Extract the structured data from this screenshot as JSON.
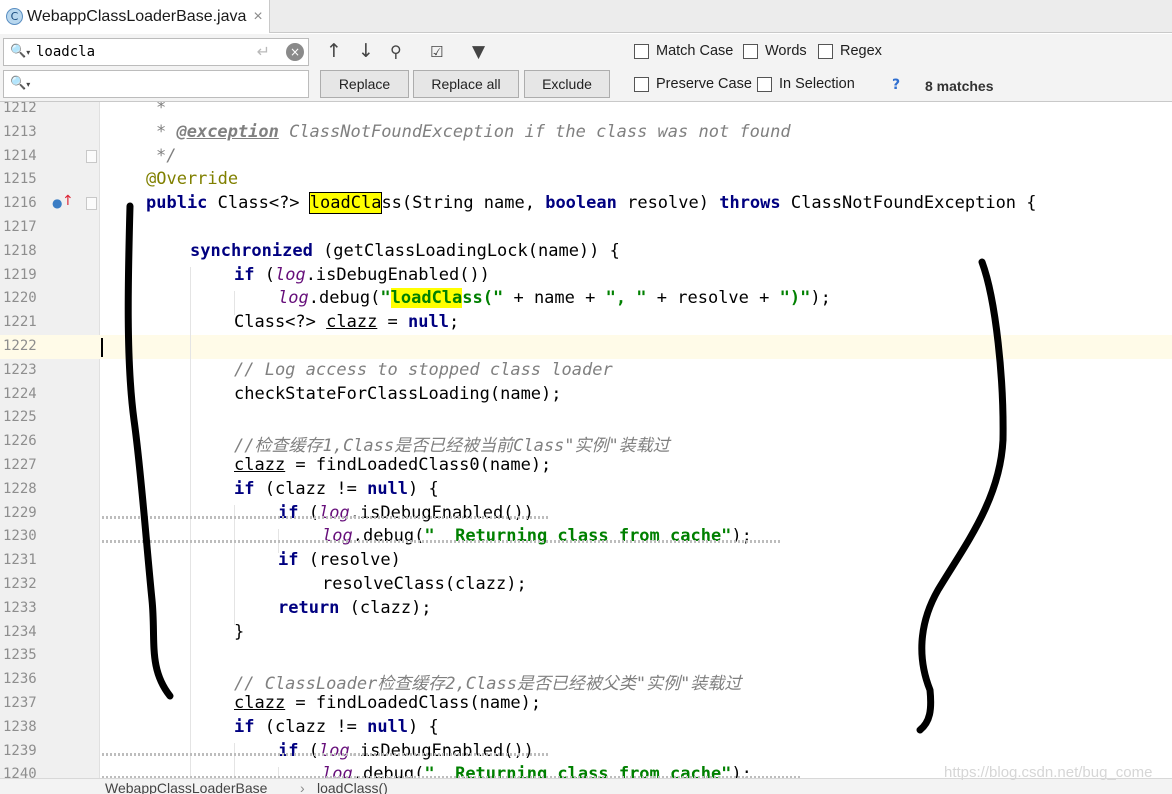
{
  "tab": {
    "icon": "C",
    "title": "WebappClassLoaderBase.java",
    "close": "×"
  },
  "search": {
    "query": "loadcla",
    "replace_value": "",
    "buttons": {
      "replace": "Replace",
      "replace_all": "Replace all",
      "exclude": "Exclude"
    },
    "options": {
      "match_case": "Match Case",
      "words": "Words",
      "regex": "Regex",
      "help": "?",
      "preserve_case": "Preserve Case",
      "in_selection": "In Selection"
    },
    "matches": "8 matches"
  },
  "editor": {
    "lines": [
      {
        "n": "1212",
        "t": [
          [
            "jdoc",
            "*"
          ]
        ]
      },
      {
        "n": "1213",
        "t": [
          [
            "jdoc",
            "* "
          ],
          [
            "jtag",
            "@exception"
          ],
          [
            "jdoc",
            " ClassNotFoundException if the class was not found"
          ]
        ]
      },
      {
        "n": "1214",
        "t": [
          [
            "jdoc",
            "*/"
          ]
        ]
      },
      {
        "n": "1215",
        "t": [
          [
            "ann",
            "@Override"
          ]
        ]
      },
      {
        "n": "1216",
        "t": [
          [
            "kw",
            "public"
          ],
          [
            "",
            " Class<?> "
          ],
          [
            "hlbox",
            "loadCla"
          ],
          [
            "",
            "ss(String name, "
          ],
          [
            "kw",
            "boolean"
          ],
          [
            "",
            " resolve) "
          ],
          [
            "kw",
            "throws"
          ],
          [
            "",
            " ClassNotFoundException {"
          ]
        ]
      },
      {
        "n": "1217",
        "t": []
      },
      {
        "n": "1218",
        "t": [
          [
            "kw",
            "synchronized"
          ],
          [
            "",
            " (getClassLoadingLock(name)) {"
          ]
        ]
      },
      {
        "n": "1219",
        "t": [
          [
            "kw",
            "if"
          ],
          [
            "",
            " ("
          ],
          [
            "fld",
            "log"
          ],
          [
            "",
            ".isDebugEnabled())"
          ]
        ]
      },
      {
        "n": "1220",
        "t": [
          [
            "fld",
            "log"
          ],
          [
            "",
            ".debug("
          ],
          [
            "str",
            "\""
          ],
          [
            "strhl",
            "loadCla"
          ],
          [
            "str",
            "ss(\""
          ],
          [
            "",
            " + name + "
          ],
          [
            "str",
            "\", \""
          ],
          [
            "",
            " + resolve + "
          ],
          [
            "str",
            "\")\""
          ],
          [
            "",
            ");"
          ]
        ]
      },
      {
        "n": "1221",
        "t": [
          [
            "",
            "Class<?> "
          ],
          [
            "und",
            "clazz"
          ],
          [
            "",
            " = "
          ],
          [
            "kwnull",
            "null"
          ],
          [
            "",
            ";"
          ]
        ]
      },
      {
        "n": "1222",
        "t": []
      },
      {
        "n": "1223",
        "t": [
          [
            "cmt",
            "// Log access to stopped class loader"
          ]
        ]
      },
      {
        "n": "1224",
        "t": [
          [
            "",
            "checkStateForClassLoading(name);"
          ]
        ]
      },
      {
        "n": "1225",
        "t": []
      },
      {
        "n": "1226",
        "t": [
          [
            "cmt",
            "//检查缓存1,Class是否已经被当前Class\"实例\"装载过"
          ]
        ]
      },
      {
        "n": "1227",
        "t": [
          [
            "und",
            "clazz"
          ],
          [
            "",
            " = findLoadedClass0(name);"
          ]
        ]
      },
      {
        "n": "1228",
        "t": [
          [
            "kw",
            "if"
          ],
          [
            "",
            " (clazz != "
          ],
          [
            "kwnull",
            "null"
          ],
          [
            "",
            ") {"
          ]
        ]
      },
      {
        "n": "1229",
        "t": [
          [
            "kw",
            "if"
          ],
          [
            "",
            " ("
          ],
          [
            "fld",
            "log"
          ],
          [
            "",
            ".isDebugEnabled())"
          ]
        ]
      },
      {
        "n": "1230",
        "t": [
          [
            "fld",
            "log"
          ],
          [
            "",
            ".debug("
          ],
          [
            "str",
            "\"  Returning class from cache\""
          ],
          [
            "",
            ");"
          ]
        ]
      },
      {
        "n": "1231",
        "t": [
          [
            "kw",
            "if"
          ],
          [
            "",
            " (resolve)"
          ]
        ]
      },
      {
        "n": "1232",
        "t": [
          [
            "",
            "resolveClass(clazz);"
          ]
        ]
      },
      {
        "n": "1233",
        "t": [
          [
            "kw",
            "return"
          ],
          [
            "",
            " (clazz);"
          ]
        ]
      },
      {
        "n": "1234",
        "t": [
          [
            "",
            "}"
          ]
        ]
      },
      {
        "n": "1235",
        "t": []
      },
      {
        "n": "1236",
        "t": [
          [
            "cmt",
            "// ClassLoader检查缓存2,Class是否已经被父类\"实例\"装载过"
          ]
        ]
      },
      {
        "n": "1237",
        "t": [
          [
            "und",
            "clazz"
          ],
          [
            "",
            " = findLoadedClass(name);"
          ]
        ]
      },
      {
        "n": "1238",
        "t": [
          [
            "kw",
            "if"
          ],
          [
            "",
            " (clazz != "
          ],
          [
            "kwnull",
            "null"
          ],
          [
            "",
            ") {"
          ]
        ]
      },
      {
        "n": "1239",
        "t": [
          [
            "kw",
            "if"
          ],
          [
            "",
            " ("
          ],
          [
            "fld",
            "log"
          ],
          [
            "",
            ".isDebugEnabled())"
          ]
        ]
      },
      {
        "n": "1240",
        "t": [
          [
            "fld",
            "log"
          ],
          [
            "",
            ".debug("
          ],
          [
            "str",
            "\"  Returning class from cache\""
          ],
          [
            "",
            ");"
          ]
        ]
      }
    ]
  },
  "breadcrumb": {
    "class_name": "WebappClassLoaderBase",
    "separator": "›",
    "method": "loadClass()"
  },
  "watermark": "https://blog.csdn.net/bug_come"
}
